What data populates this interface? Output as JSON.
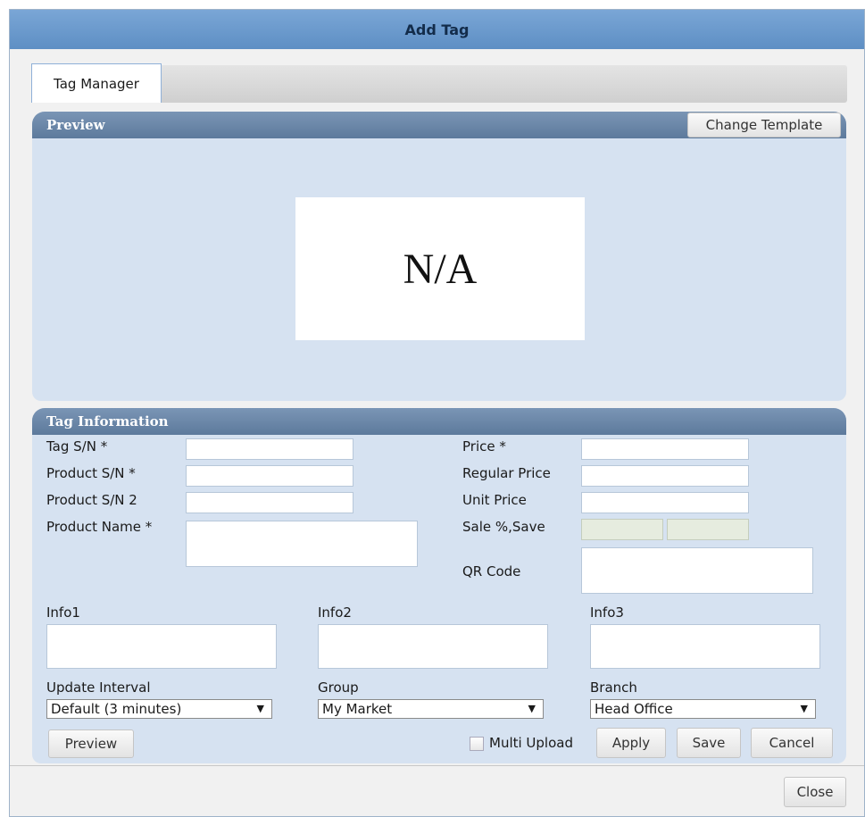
{
  "dialog": {
    "title": "Add Tag"
  },
  "tabs": [
    {
      "label": "Tag Manager"
    }
  ],
  "preview": {
    "header": "Preview",
    "change_template_label": "Change Template",
    "placeholder_text": "N/A"
  },
  "info": {
    "header": "Tag Information",
    "fields": {
      "tag_sn": "Tag S/N *",
      "product_sn": "Product S/N *",
      "product_sn2": "Product S/N 2",
      "product_name": "Product Name *",
      "price": "Price *",
      "regular_price": "Regular Price",
      "unit_price": "Unit Price",
      "sale_save": "Sale %,Save",
      "qr_code": "QR Code",
      "info1": "Info1",
      "info2": "Info2",
      "info3": "Info3",
      "update_interval": "Update Interval",
      "group": "Group",
      "branch": "Branch"
    },
    "selects": {
      "update_interval": "Default (3 minutes)",
      "group": "My Market",
      "branch": "Head Office"
    },
    "buttons": {
      "preview": "Preview",
      "multi_upload": "Multi Upload",
      "apply": "Apply",
      "save": "Save",
      "cancel": "Cancel"
    }
  },
  "footer": {
    "close_label": "Close"
  }
}
